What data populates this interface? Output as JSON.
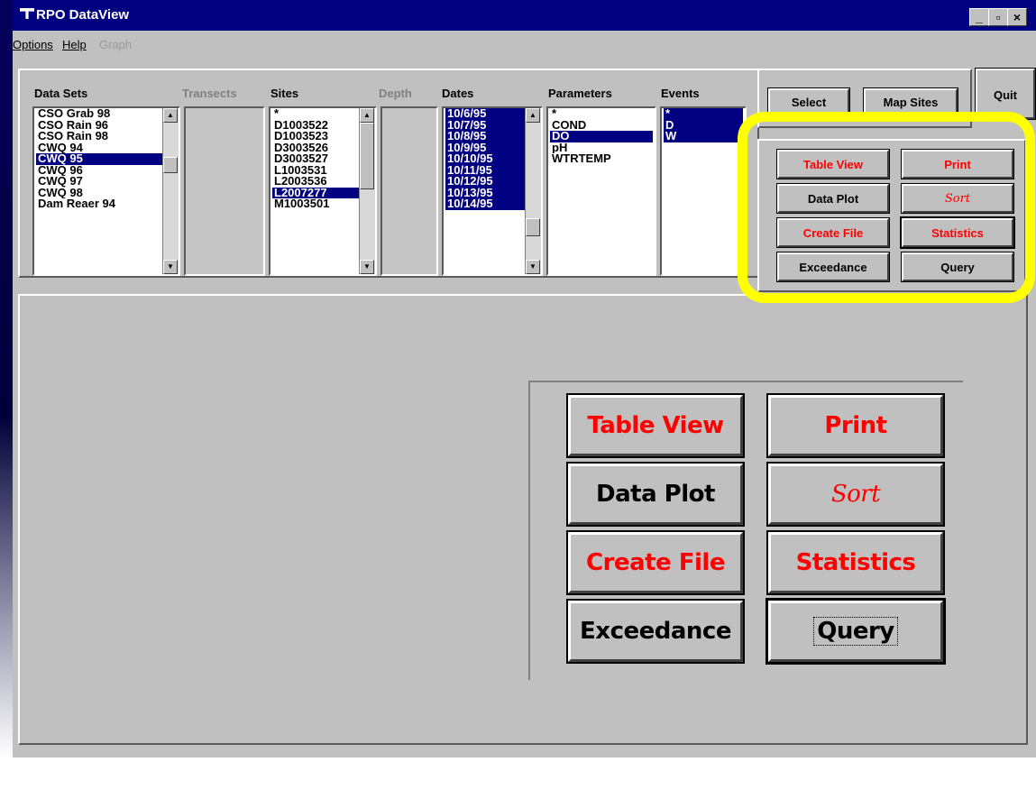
{
  "window": {
    "title": "RPO DataView",
    "controls": {
      "minimize": "_",
      "maximize": "▫",
      "close": "×"
    }
  },
  "menu": {
    "options": "Options",
    "help": "Help",
    "graph": "Graph"
  },
  "lists": {
    "data_sets": {
      "label": "Data Sets",
      "items": [
        "CSO Grab 98",
        "CSO Rain 96",
        "CSO Rain 98",
        "CWQ 94",
        "CWQ 95",
        "CWQ 96",
        "CWQ 97",
        "CWQ 98",
        "Dam Reaer 94"
      ],
      "selected": "CWQ 95"
    },
    "transects": {
      "label": "Transects",
      "items": []
    },
    "sites": {
      "label": "Sites",
      "items": [
        "*",
        "D1003522",
        "D1003523",
        "D3003526",
        "D3003527",
        "L1003531",
        "L2003536",
        "L2007277",
        "M1003501"
      ],
      "selected": "L2007277"
    },
    "depth": {
      "label": "Depth",
      "items": []
    },
    "dates": {
      "label": "Dates",
      "items": [
        "10/6/95",
        "10/7/95",
        "10/8/95",
        "10/9/95",
        "10/10/95",
        "10/11/95",
        "10/12/95",
        "10/13/95",
        "10/14/95"
      ],
      "selected": "all"
    },
    "parameters": {
      "label": "Parameters",
      "items": [
        "*",
        "COND",
        "DO",
        "pH",
        "WTRTEMP"
      ],
      "selected": "DO"
    },
    "events": {
      "label": "Events",
      "items": [
        "*",
        "D",
        "W"
      ],
      "selected": "all"
    }
  },
  "buttons": {
    "select": "Select",
    "map_sites": "Map Sites",
    "quit": "Quit",
    "table_view": "Table View",
    "print": "Print",
    "data_plot": "Data Plot",
    "sort": "Sort",
    "create_file": "Create File",
    "statistics": "Statistics",
    "exceedance": "Exceedance",
    "query": "Query"
  },
  "colors": {
    "title_bar": "#000080",
    "selection": "#000080",
    "red_label": "#ff0000",
    "highlight_ring": "#ffff00"
  }
}
